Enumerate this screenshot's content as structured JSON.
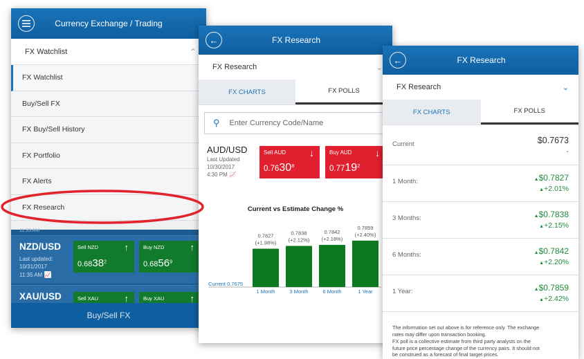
{
  "screen1": {
    "title": "Currency Exchange / Trading",
    "dropdown_label": "FX Watchlist",
    "menu": [
      "FX Watchlist",
      "Buy/Sell FX",
      "FX Buy/Sell History",
      "FX Portfolio",
      "FX Alerts",
      "FX Research"
    ],
    "peek_text": "11:35 AM",
    "quotes": [
      {
        "pair": "NZD/USD",
        "updated_label": "Last updated:",
        "date": "10/31/2017",
        "time": "11:35 AM",
        "sell_label": "Sell  NZD",
        "sell_pre": "0.68",
        "sell_big": "38",
        "sell_sup": "2",
        "buy_label": "Buy  NZD",
        "buy_pre": "0.68",
        "buy_big": "56",
        "buy_sup": "9"
      },
      {
        "pair": "XAU/USD",
        "sell_label": "Sell  XAU",
        "buy_label": "Buy  XAU"
      }
    ],
    "bottom_button": "Buy/Sell FX"
  },
  "screen2": {
    "title": "FX Research",
    "dropdown_label": "FX Research",
    "tabs": [
      "FX CHARTS",
      "FX POLLS"
    ],
    "search_placeholder": "Enter Currency Code/Name",
    "pair": "AUD/USD",
    "updated_label": "Last Updated",
    "date": "10/30/2017",
    "time": "4:30 PM",
    "sell": {
      "label": "Sell  AUD",
      "pre": "0.76",
      "big": "30",
      "sup": "8"
    },
    "buy": {
      "label": "Buy  AUD",
      "pre": "0.77",
      "big": "19",
      "sup": "2"
    }
  },
  "chart_data": {
    "type": "bar",
    "title": "Current vs Estimate Change %",
    "categories": [
      "1 Month",
      "3 Month",
      "6 Month",
      "1 Year"
    ],
    "values": [
      0.7827,
      0.7838,
      0.7842,
      0.7859
    ],
    "value_labels": [
      "0.7827",
      "0.7838",
      "0.7842",
      "0.7859"
    ],
    "change_labels": [
      "(+1.98%)",
      "(+2.12%)",
      "(+2.18%)",
      "(+2.40%)"
    ],
    "baseline": 0.7675,
    "baseline_label": "Current 0.7675",
    "color": "#0c7a1e"
  },
  "screen3": {
    "title": "FX Research",
    "dropdown_label": "FX Research",
    "tabs": [
      "FX CHARTS",
      "FX POLLS"
    ],
    "current_label": "Current",
    "current_value": "$0.7673",
    "current_change": "-",
    "rows": [
      {
        "label": "1 Month:",
        "value": "$0.7827",
        "change": "+2.01%"
      },
      {
        "label": "3 Months:",
        "value": "$0.7838",
        "change": "+2.15%"
      },
      {
        "label": "6 Months:",
        "value": "$0.7842",
        "change": "+2.20%"
      },
      {
        "label": "1 Year:",
        "value": "$0.7859",
        "change": "+2.42%"
      }
    ],
    "note_lines": [
      "The information set out above is for reference only. The exchange",
      "rates may differ upon transaction booking.",
      "FX poll is a collective estimate from third party analysts on the",
      "future price percentage change of the currency pairs. It should not",
      "be construed as a forecast of final target prices."
    ]
  },
  "colors": {
    "brand_blue": "#1a73b8",
    "sell_red": "#e0202e",
    "buy_green": "#127a2c",
    "up_green": "#1f8a3a",
    "highlight": "#e3232c"
  }
}
